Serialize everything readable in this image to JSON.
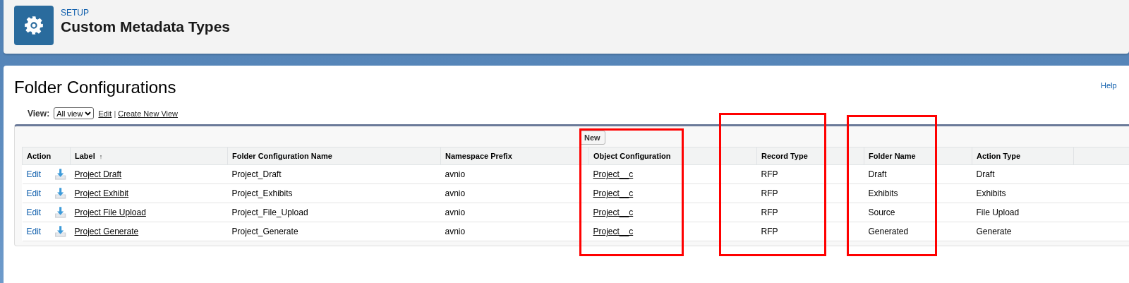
{
  "header": {
    "eyebrow": "SETUP",
    "title": "Custom Metadata Types"
  },
  "page": {
    "title": "Folder Configurations",
    "help_link": "Help"
  },
  "view": {
    "label": "View:",
    "selected_view": "All view",
    "edit_link": "Edit",
    "separator": "|",
    "create_link": "Create New View"
  },
  "toolbar": {
    "new_button": "New"
  },
  "table": {
    "columns": [
      {
        "label": "Action",
        "kind": "action",
        "highlighted": false
      },
      {
        "label": "Label",
        "kind": "link",
        "sort_indicator": "↑",
        "highlighted": false
      },
      {
        "label": "Folder Configuration Name",
        "kind": "text",
        "highlighted": false
      },
      {
        "label": "Namespace Prefix",
        "kind": "text",
        "highlighted": false
      },
      {
        "label": "Object Configuration",
        "kind": "link",
        "highlighted": true
      },
      {
        "label": "Record Type",
        "kind": "text",
        "highlighted": true
      },
      {
        "label": "Folder Name",
        "kind": "text",
        "highlighted": true
      },
      {
        "label": "Action Type",
        "kind": "text",
        "highlighted": false
      }
    ],
    "rows": [
      {
        "cells": [
          "Edit",
          "Project Draft",
          "Project_Draft",
          "avnio",
          "Project__c",
          "RFP",
          "Draft",
          "Draft"
        ]
      },
      {
        "cells": [
          "Edit",
          "Project Exhibit",
          "Project_Exhibits",
          "avnio",
          "Project__c",
          "RFP",
          "Exhibits",
          "Exhibits"
        ]
      },
      {
        "cells": [
          "Edit",
          "Project File Upload",
          "Project_File_Upload",
          "avnio",
          "Project__c",
          "RFP",
          "Source",
          "File Upload"
        ]
      },
      {
        "cells": [
          "Edit",
          "Project Generate",
          "Project_Generate",
          "avnio",
          "Project__c",
          "RFP",
          "Generated",
          "Generate"
        ]
      }
    ]
  }
}
